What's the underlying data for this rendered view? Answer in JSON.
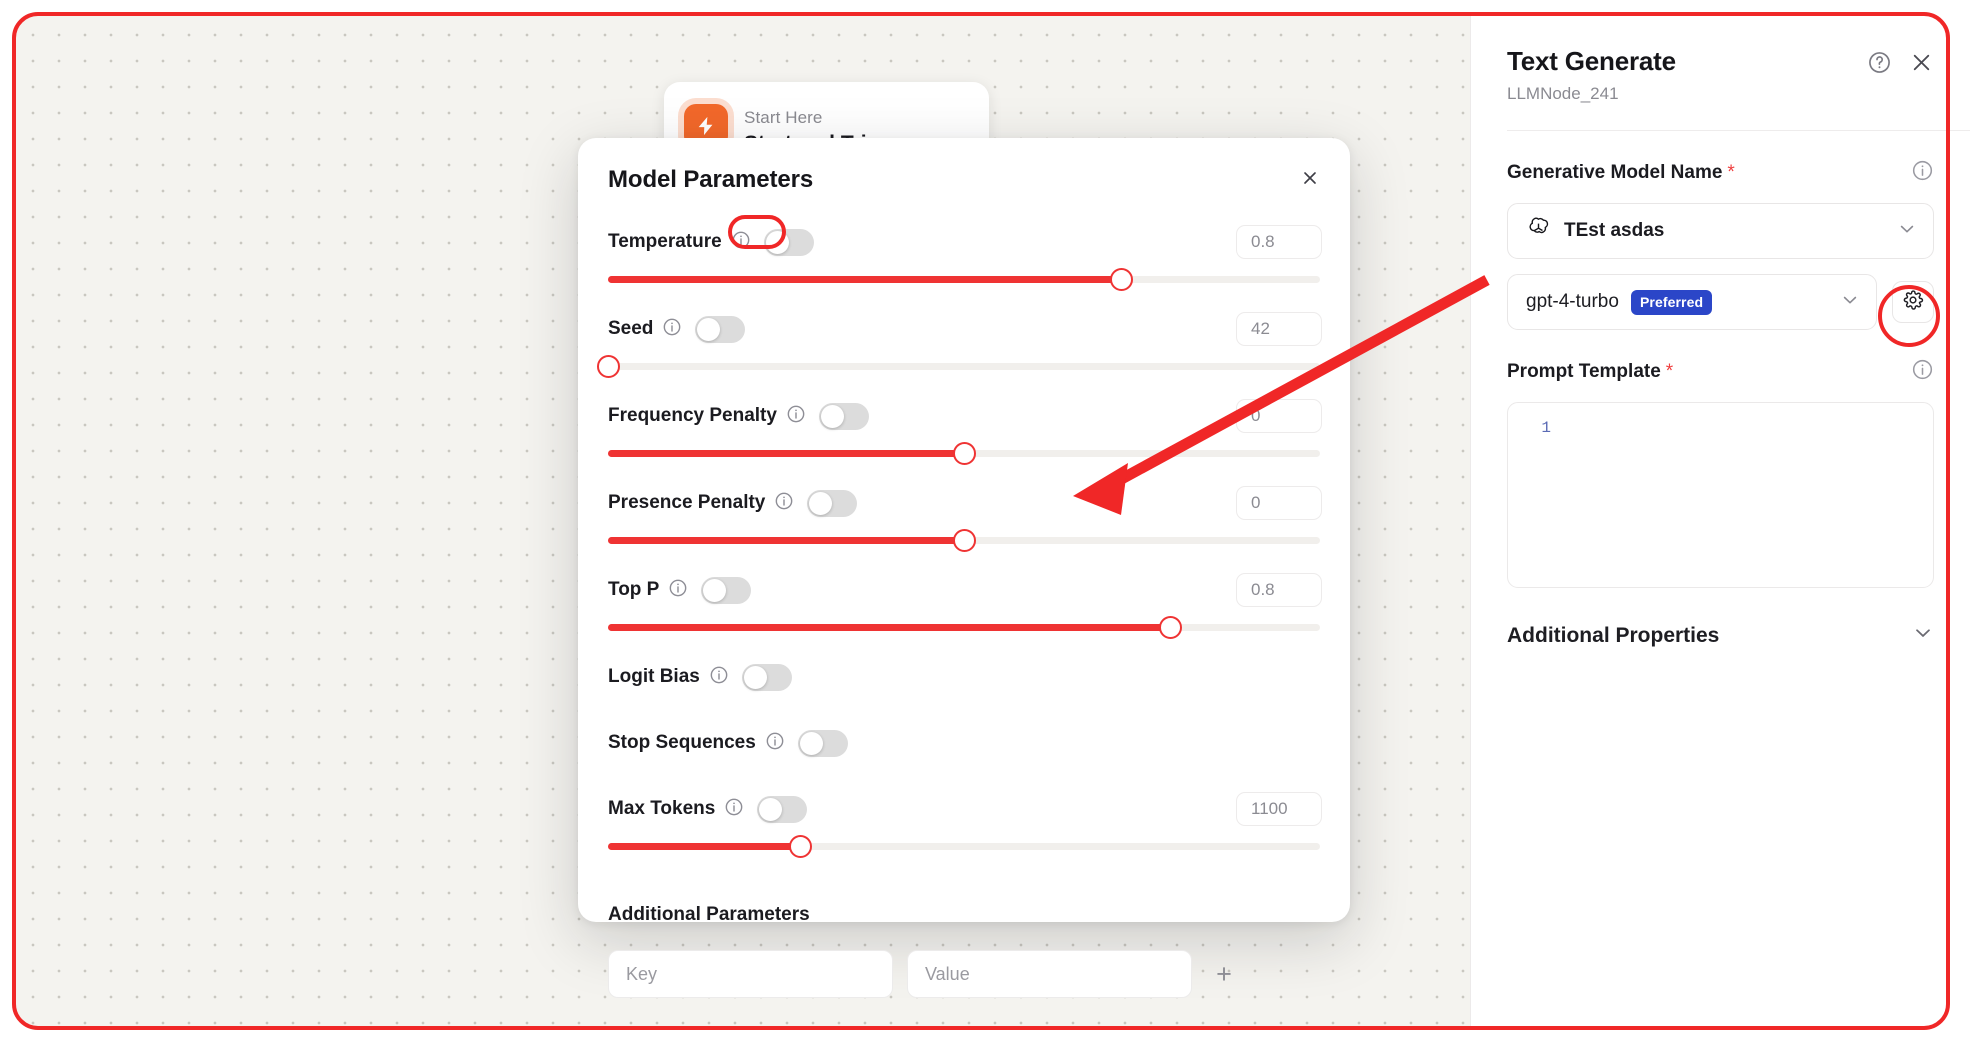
{
  "canvas": {
    "node": {
      "icon": "lightning-bolt-icon",
      "subtitle": "Start Here",
      "title": "Start and Trigger"
    }
  },
  "modal": {
    "title": "Model Parameters",
    "close_icon": "close-icon",
    "parameters": [
      {
        "label": "Temperature",
        "info_icon": "info-icon",
        "toggle_on": false,
        "has_value": true,
        "value": "0.8",
        "has_slider": true,
        "fill_pct": 72
      },
      {
        "label": "Seed",
        "info_icon": "info-icon",
        "toggle_on": false,
        "has_value": true,
        "value": "42",
        "has_slider": true,
        "fill_pct": 0
      },
      {
        "label": "Frequency Penalty",
        "info_icon": "info-icon",
        "toggle_on": false,
        "has_value": true,
        "value": "0",
        "has_slider": true,
        "fill_pct": 50
      },
      {
        "label": "Presence Penalty",
        "info_icon": "info-icon",
        "toggle_on": false,
        "has_value": true,
        "value": "0",
        "has_slider": true,
        "fill_pct": 50
      },
      {
        "label": "Top P",
        "info_icon": "info-icon",
        "toggle_on": false,
        "has_value": true,
        "value": "0.8",
        "has_slider": true,
        "fill_pct": 79
      },
      {
        "label": "Logit Bias",
        "info_icon": "info-icon",
        "toggle_on": false,
        "has_value": false,
        "value": "",
        "has_slider": false,
        "fill_pct": 0
      },
      {
        "label": "Stop Sequences",
        "info_icon": "info-icon",
        "toggle_on": false,
        "has_value": false,
        "value": "",
        "has_slider": false,
        "fill_pct": 0
      },
      {
        "label": "Max Tokens",
        "info_icon": "info-icon",
        "toggle_on": false,
        "has_value": true,
        "value": "1100",
        "has_slider": true,
        "fill_pct": 27
      }
    ],
    "additional_parameters": {
      "title": "Additional Parameters",
      "key_placeholder": "Key",
      "value_placeholder": "Value",
      "add_icon": "plus-icon"
    }
  },
  "panel": {
    "title": "Text Generate",
    "subtitle": "LLMNode_241",
    "help_icon": "help-circle-icon",
    "close_icon": "close-icon",
    "model_name_field": {
      "label": "Generative Model Name",
      "required_marker": "*",
      "info_icon": "info-icon",
      "provider_icon": "openai-icon",
      "selected": "TEst asdas",
      "chevron_icon": "chevron-down-icon"
    },
    "model_field": {
      "selected": "gpt-4-turbo",
      "badge": "Preferred",
      "chevron_icon": "chevron-down-icon",
      "settings_icon": "gear-icon"
    },
    "prompt_template": {
      "label": "Prompt Template",
      "required_marker": "*",
      "info_icon": "info-icon",
      "line_number": "1",
      "content": ""
    },
    "additional_properties": {
      "label": "Additional Properties",
      "chevron_icon": "chevron-down-icon"
    }
  },
  "annotations": {
    "accent_color": "#f02727",
    "arrow": "gear-to-modal-arrow",
    "highlight_gear": "gear-highlight-ring",
    "highlight_toggle": "temperature-toggle-highlight-ring"
  }
}
